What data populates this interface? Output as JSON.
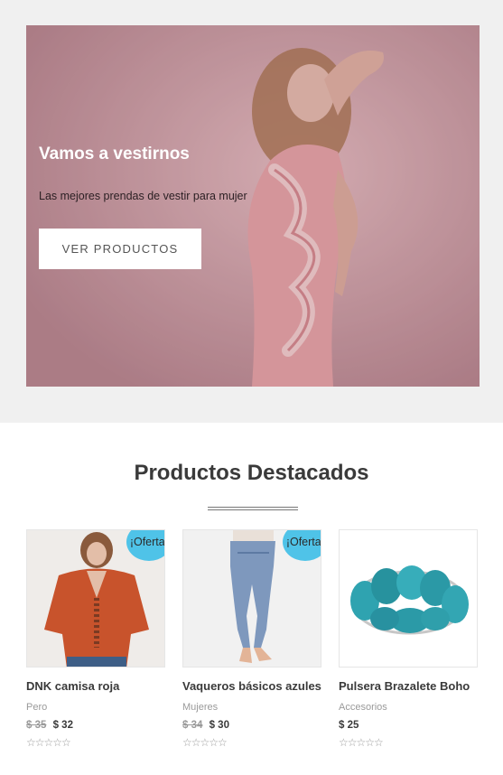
{
  "hero": {
    "title": "Vamos a vestirnos",
    "subtitle": "Las mejores prendas de vestir para mujer",
    "button_label": "VER PRODUCTOS"
  },
  "featured": {
    "title": "Productos Destacados"
  },
  "products": [
    {
      "name": "DNK camisa roja",
      "category": "Pero",
      "old_price": "$ 35",
      "price": "$ 32",
      "badge": "¡Oferta!",
      "stars": "☆☆☆☆☆"
    },
    {
      "name": "Vaqueros básicos azules",
      "category": "Mujeres",
      "old_price": "$ 34",
      "price": "$ 30",
      "badge": "¡Oferta!",
      "stars": "☆☆☆☆☆"
    },
    {
      "name": "Pulsera Brazalete Boho",
      "category": "Accesorios",
      "price": "$ 25",
      "stars": "☆☆☆☆☆"
    }
  ],
  "colors": {
    "badge": "#4fc3e8",
    "hero_tint": "#c79ca3"
  }
}
